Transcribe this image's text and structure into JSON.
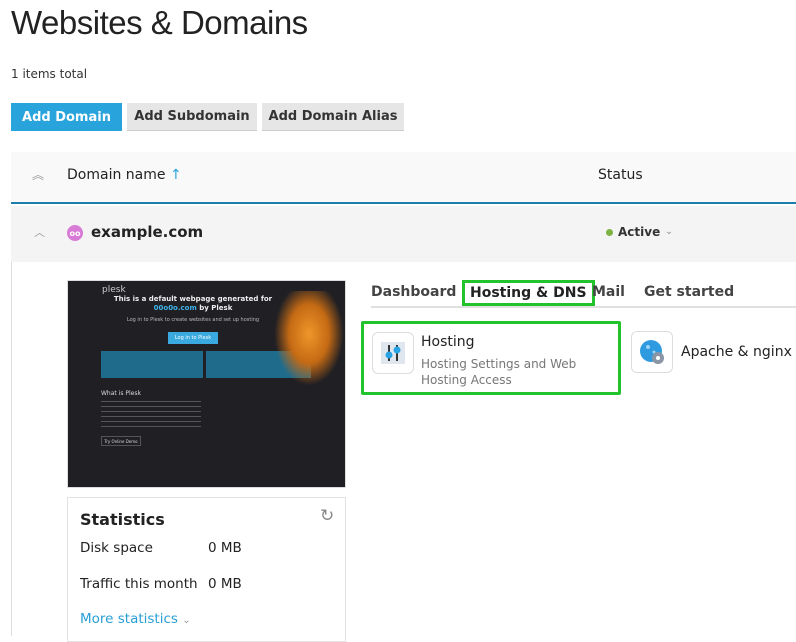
{
  "page": {
    "title": "Websites & Domains",
    "total": "1 items total"
  },
  "toolbar": {
    "add_domain": "Add Domain",
    "add_subdomain": "Add Subdomain",
    "add_alias": "Add Domain Alias"
  },
  "table": {
    "col_domain": "Domain name",
    "sort_arrow": "↑",
    "col_status": "Status"
  },
  "domain": {
    "name": "example.com",
    "avatar": "oo",
    "status": "Active",
    "status_color": "#7cb342"
  },
  "preview": {
    "brand": "plesk",
    "headline": "This is a default webpage generated for",
    "domain": "00o0o.com",
    "by": "by Plesk",
    "sub": "Log in to Plesk to create websites and set up hosting",
    "login": "Log in to Plesk",
    "what": "What is Plesk",
    "demo": "Try Online Demo"
  },
  "tabs": [
    "Dashboard",
    "Hosting & DNS",
    "Mail",
    "Get started"
  ],
  "cards": {
    "hosting_title": "Hosting",
    "hosting_desc": "Hosting Settings and Web Hosting Access",
    "apache": "Apache & nginx"
  },
  "stats": {
    "title": "Statistics",
    "disk_label": "Disk space",
    "disk_value": "0 MB",
    "traffic_label": "Traffic this month",
    "traffic_value": "0 MB",
    "more": "More statistics"
  },
  "colors": {
    "accent": "#28a3dc",
    "highlight": "#22c32b"
  }
}
